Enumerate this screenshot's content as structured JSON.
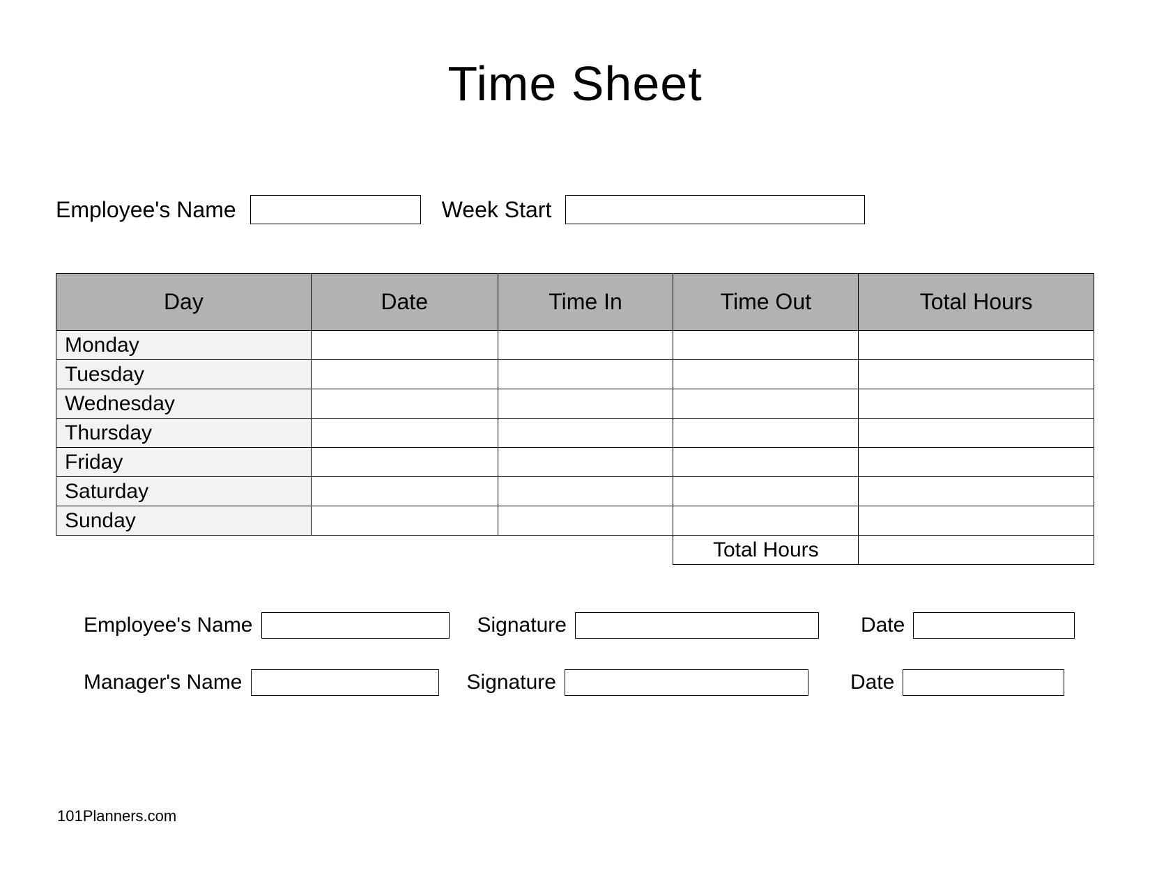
{
  "title": "Time Sheet",
  "top": {
    "employee_name_label": "Employee's Name",
    "employee_name_value": "",
    "week_start_label": "Week Start",
    "week_start_value": ""
  },
  "table": {
    "headers": {
      "day": "Day",
      "date": "Date",
      "time_in": "Time In",
      "time_out": "Time Out",
      "total_hours": "Total Hours"
    },
    "rows": [
      {
        "day": "Monday",
        "date": "",
        "time_in": "",
        "time_out": "",
        "total": ""
      },
      {
        "day": "Tuesday",
        "date": "",
        "time_in": "",
        "time_out": "",
        "total": ""
      },
      {
        "day": "Wednesday",
        "date": "",
        "time_in": "",
        "time_out": "",
        "total": ""
      },
      {
        "day": "Thursday",
        "date": "",
        "time_in": "",
        "time_out": "",
        "total": ""
      },
      {
        "day": "Friday",
        "date": "",
        "time_in": "",
        "time_out": "",
        "total": ""
      },
      {
        "day": "Saturday",
        "date": "",
        "time_in": "",
        "time_out": "",
        "total": ""
      },
      {
        "day": "Sunday",
        "date": "",
        "time_in": "",
        "time_out": "",
        "total": ""
      }
    ],
    "footer": {
      "total_hours_label": "Total Hours",
      "total_hours_value": ""
    }
  },
  "signoff": {
    "employee": {
      "name_label": "Employee's Name",
      "name_value": "",
      "signature_label": "Signature",
      "signature_value": "",
      "date_label": "Date",
      "date_value": ""
    },
    "manager": {
      "name_label": "Manager's Name",
      "name_value": "",
      "signature_label": "Signature",
      "signature_value": "",
      "date_label": "Date",
      "date_value": ""
    }
  },
  "attribution": "101Planners.com"
}
